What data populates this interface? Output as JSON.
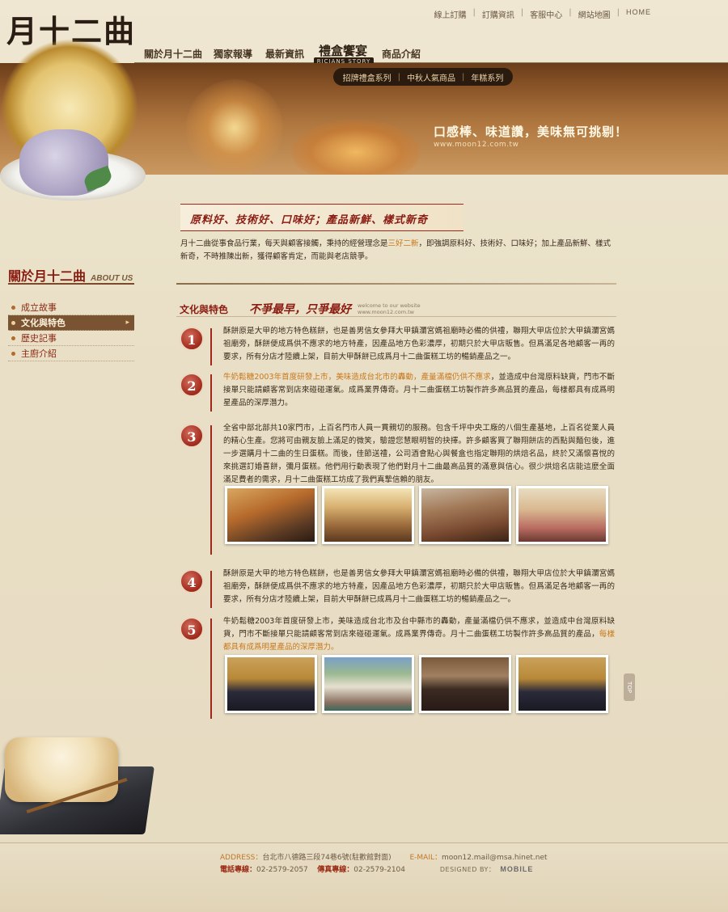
{
  "brand": {
    "logo_text": "月十二曲"
  },
  "toplinks": {
    "items": [
      "線上訂購",
      "訂購資訊",
      "客服中心",
      "網站地圖"
    ],
    "home": "HOME"
  },
  "nav": {
    "items": [
      "關於月十二曲",
      "獨家報導",
      "最新資訊",
      "禮盒饗宴",
      "商品介紹"
    ],
    "story_badge": "RICIANS STORY"
  },
  "banner": {
    "subnav": [
      "招牌禮盒系列",
      "中秋人氣商品",
      "年糕系列"
    ],
    "slogan": "口感棒、味道讚，美味無可挑剔！",
    "url": "www.moon12.com.tw"
  },
  "sidebar": {
    "title": "關於月十二曲",
    "title_en": "ABOUT US",
    "items": [
      "成立故事",
      "文化與特色",
      "歷史記事",
      "主廚介紹"
    ],
    "active_index": 1
  },
  "main": {
    "headline": "原料好、技術好、口味好；產品新鮮、樣式新奇",
    "intro_pre": "月十二曲從事食品行業，每天與顧客接觸，秉持的經營理念是",
    "intro_hl": "三好二新",
    "intro_post": "，即強調原料好、技術好、口味好；加上產品新鮮、樣式新奇，不時推陳出新，獲得顧客肯定，而能與老店競爭。",
    "section_title": "文化與特色",
    "section_motto": "不爭最早，只爭最好",
    "section_en_1": "welcome to our website",
    "section_en_2": "www.moon12.com.tw",
    "items": [
      {
        "num": "1",
        "text": "酥餅原是大甲的地方特色糕餅，也是善男信女參拜大甲鎮瀾宮媽祖廟時必備的供禮，聯翔大甲店位於大甲鎮瀾宮媽祖廟旁，酥餅便成爲供不應求的地方特產，因產品地方色彩濃厚，初期只於大甲店販售。但爲滿足各地顧客一再的要求，所有分店才陸續上架，目前大甲酥餅已成爲月十二曲蛋糕工坊的暢銷產品之一。"
      },
      {
        "num": "2",
        "text_or": "牛奶鬆糖2003年首度研發上市，美味造成台北市的轟動，產量滿檔仍供不應求",
        "text": "，並造成中台灣原料缺貨，門市不斷接單只能請顧客常到店來碰碰運氣。成爲業界傳奇。月十二曲蛋糕工坊製作許多高品質的產品，每樣都具有成爲明星產品的深厚潛力。"
      },
      {
        "num": "3",
        "text": "全省中部北部共10家門市，上百名門市人員一貫親切的服務。包含千坪中央工廠的八個生產基地，上百名從業人員的精心生產。您將可由親友臉上滿足的微笑，驗證您慧眼明智的抉擇。許多顧客買了聯翔餅店的西點與麵包後，進一步選購月十二曲的生日蛋糕。而後，佳節送禮，公司酒會點心與餐盒也指定聯翔的烘焙名品，終於又滿懷喜悅的來挑選訂婚喜餅，彌月蛋糕。他們用行動表現了他們對月十二曲最高品質的滿意與信心。很少烘焙名店能這麼全面滿足費者的需求，月十二曲蛋糕工坊成了我們真摯信賴的朋友。"
      },
      {
        "num": "4",
        "text": "酥餅原是大甲的地方特色糕餅，也是善男信女參拜大甲鎮瀾宮媽祖廟時必備的供禮，聯翔大甲店位於大甲鎮瀾宮媽祖廟旁，酥餅便成爲供不應求的地方特產，因產品地方色彩濃厚，初期只於大甲店販售。但爲滿足各地顧客一再的要求，所有分店才陸續上架，目前大甲酥餅已成爲月十二曲蛋糕工坊的暢銷產品之一。"
      },
      {
        "num": "5",
        "text": "牛奶鬆糖2003年首度研發上市，美味造成台北市及台中縣市的轟動，產量滿檔仍供不應求，並造成中台灣原料缺貨，門市不斷接單只能請顧客常到店來碰碰運氣。成爲業界傳奇。月十二曲蛋糕工坊製作許多高品質的產品，",
        "text_or": "每樣都具有成爲明星產品的深厚潛力。"
      }
    ]
  },
  "top_button": "TOP",
  "footer": {
    "address_label": "ADDRESS：",
    "address": "台北市八德路三段74巷6號(駐歡館對面)",
    "email_label": "E-MAIL：",
    "email": "moon12.mail@msa.hinet.net",
    "phone_label": "電話專線：",
    "phone": "02-2579-2057",
    "fax_label": "傳真專線：",
    "fax": "02-2579-2104",
    "designed_label": "DESIGNED BY：",
    "designer": "MOBILE"
  }
}
